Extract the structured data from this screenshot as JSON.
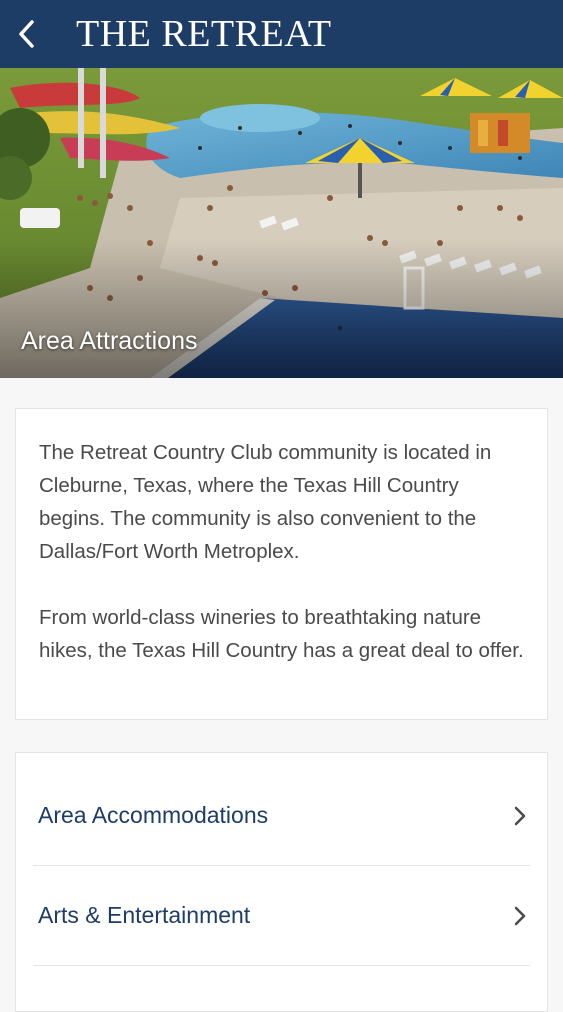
{
  "navbar": {
    "title": "THE RETREAT",
    "back_icon": "chevron-left-icon"
  },
  "hero": {
    "caption": "Area Attractions",
    "image": "water-park-photo"
  },
  "intro": {
    "paragraph_1": "The Retreat Country Club community is located in Cleburne, Texas, where the Texas Hill Country begins. The community is also convenient to the Dallas/Fort Worth Metroplex.",
    "paragraph_2": "From world-class wineries to breathtaking nature hikes, the Texas Hill Country has a great deal to offer."
  },
  "categories": {
    "items": [
      {
        "label": "Area Accommodations",
        "icon": "chevron-right-icon"
      },
      {
        "label": "Arts & Entertainment",
        "icon": "chevron-right-icon"
      }
    ]
  },
  "colors": {
    "navbar_bg": "#1d3c66",
    "link_text": "#1d3c66",
    "body_text": "#4a4a4a"
  }
}
